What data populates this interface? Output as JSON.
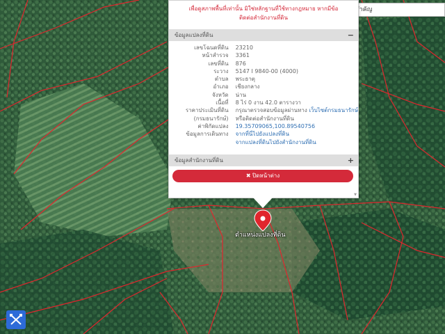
{
  "notice": {
    "line1": "เพื่อดูสภาพพื้นที่เท่านั้น มิใช่หลักฐานที่ใช้ทางกฎหมาย หากมีข้อ",
    "line2": "ติดต่อสำนักงานที่ดิน"
  },
  "search": {
    "value": "ค้นหาสถานที่สำคัญ"
  },
  "parcel_section": {
    "title": "ข้อมูลแปลงที่ดิน",
    "toggle": "−"
  },
  "parcel_rows": [
    {
      "label": "เลขโฉนดที่ดิน",
      "value": "23210"
    },
    {
      "label": "หน้าสำรวจ",
      "value": "3361"
    },
    {
      "label": "เลขที่ดิน",
      "value": "876"
    },
    {
      "label": "ระวาง",
      "value": "5147 I 9840-00 (4000)"
    },
    {
      "label": "ตำบล",
      "value": "พระธาตุ"
    },
    {
      "label": "อำเภอ",
      "value": "เชียงกลาง"
    },
    {
      "label": "จังหวัด",
      "value": "น่าน"
    },
    {
      "label": "เนื้อที่",
      "value": "8 ไร่ 0 งาน 42.0 ตารางวา"
    },
    {
      "label": "ราคาประเมินที่ดิน",
      "value": "กรุณาตรวจสอบข้อมูลผ่านทาง",
      "link": "เว็บไซต์กรมธนารักษ์"
    },
    {
      "label": "(กรมธนารักษ์)",
      "value": "หรือติดต่อสำนักงานที่ดิน"
    },
    {
      "label": "ค่าพิกัดแปลง",
      "link": "19.35709065,100.89540756"
    },
    {
      "label": "ข้อมูลการเดินทาง",
      "link": "จากที่นี่ไปยังแปลงที่ดิน"
    },
    {
      "label": "",
      "link": "จากแปลงที่ดินไปยังสำนักงานที่ดิน"
    }
  ],
  "office_section": {
    "title": "ข้อมูลสำนักงานที่ดิน",
    "toggle": "+"
  },
  "close_button": {
    "label": "✖ ปิดหน้าต่าง"
  },
  "pin": {
    "label": "ตำแหน่งแปลงที่ดิน",
    "color": "#e0262d"
  },
  "tool_button": {
    "icon": "crossed-tools-icon",
    "color": "#2d6bd8"
  },
  "colors": {
    "accent": "#d42a3a",
    "link": "#2f6fb3",
    "parcel_border": "#e0262d"
  }
}
